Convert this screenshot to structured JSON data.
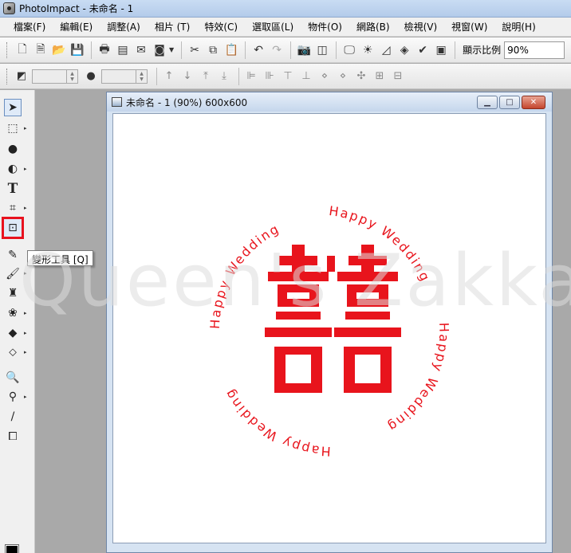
{
  "app": {
    "title": "PhotoImpact - 未命名 - 1"
  },
  "menu": [
    {
      "label": "檔案(F)"
    },
    {
      "label": "編輯(E)"
    },
    {
      "label": "調整(A)"
    },
    {
      "label": "相片 (T)"
    },
    {
      "label": "特效(C)"
    },
    {
      "label": "選取區(L)"
    },
    {
      "label": "物件(O)"
    },
    {
      "label": "網路(B)"
    },
    {
      "label": "檢視(V)"
    },
    {
      "label": "視窗(W)"
    },
    {
      "label": "說明(H)"
    }
  ],
  "toolbar": {
    "zoom_label": "顯示比例",
    "zoom_value": "90%"
  },
  "tooltip": {
    "text": "變形工具 [Q]"
  },
  "document": {
    "title": "未命名 - 1 (90%) 600x600"
  },
  "canvas": {
    "center_text": "囍",
    "ring_text_1": "Happy Wedding",
    "ring_text_2": "Happy Wedding",
    "ring_text_3": "Happy Wedding",
    "ring_text_4": "Happy Wedding",
    "accent_color": "#e8141c"
  },
  "watermark": {
    "text": "Queen's Zakka"
  }
}
